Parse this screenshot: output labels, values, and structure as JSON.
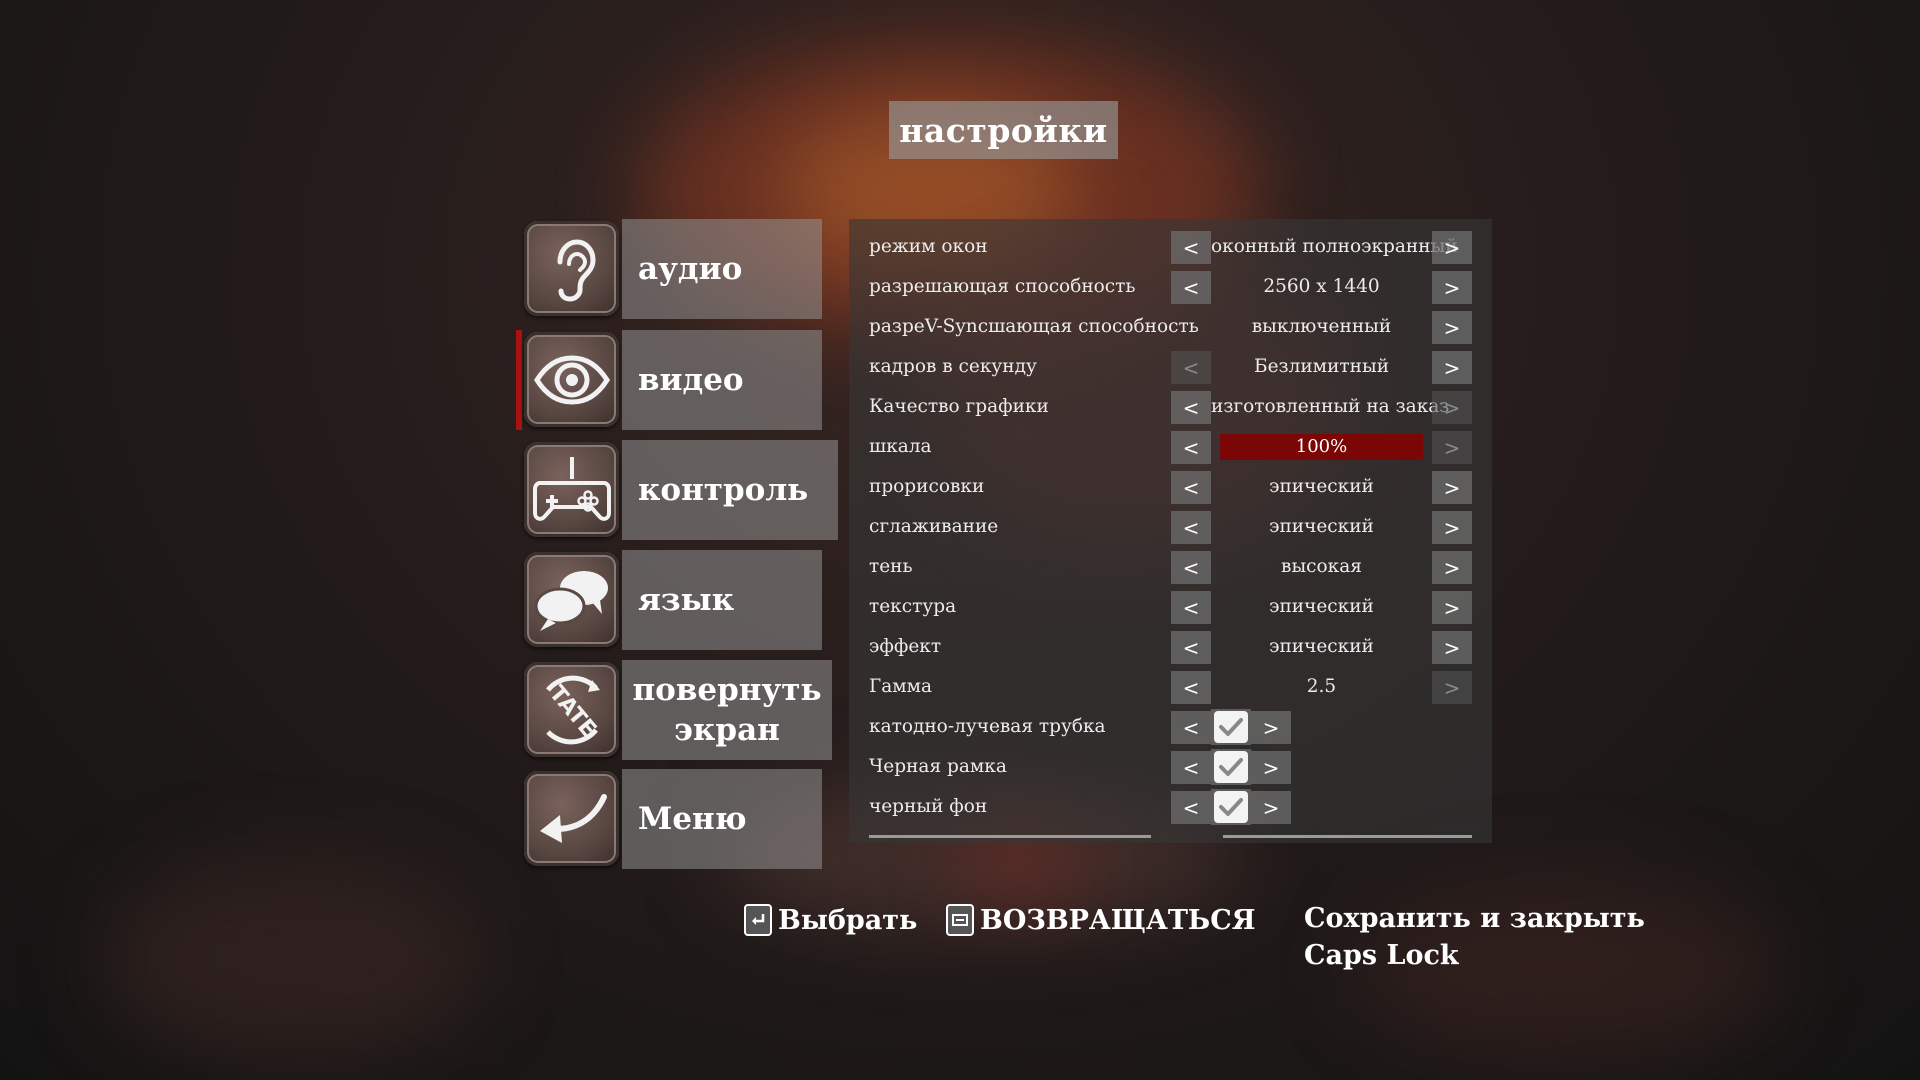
{
  "title": "настройки",
  "menu": [
    {
      "label": "аудио",
      "icon": "ear-icon"
    },
    {
      "label": "видео",
      "icon": "eye-icon",
      "active": true
    },
    {
      "label": "контроль",
      "icon": "gamepad-icon"
    },
    {
      "label": "язык",
      "icon": "speech-bubbles-icon"
    },
    {
      "label": "повернуть экран",
      "icon": "tate-rotate-icon",
      "icon_text": "TATE"
    },
    {
      "label": "Меню",
      "icon": "back-arrow-icon"
    }
  ],
  "settings": [
    {
      "name": "режим окон",
      "value": "оконный полноэкранный"
    },
    {
      "name": "разрешающая способность",
      "value": "2560 x 1440"
    },
    {
      "name": "разреV-Syncшающая способность",
      "value": "выключенный"
    },
    {
      "name": "кадров в секунду",
      "value": "Безлимитный"
    },
    {
      "name": "Качество графики",
      "value": "изготовленный на заказ"
    },
    {
      "name": "шкала",
      "value": "100%",
      "fill": 1.0
    },
    {
      "name": "прорисовки",
      "value": "эпический"
    },
    {
      "name": "сглаживание",
      "value": "эпический"
    },
    {
      "name": "тень",
      "value": "высокая"
    },
    {
      "name": "текстура",
      "value": "эпический"
    },
    {
      "name": "эффект",
      "value": "эпический"
    },
    {
      "name": "Гамма",
      "value": "2.5"
    },
    {
      "name": "катодно-лучевая трубка",
      "checked": true
    },
    {
      "name": "Черная рамка",
      "checked": true
    },
    {
      "name": "черный фон",
      "checked": true
    }
  ],
  "arrows": {
    "left": "<",
    "right": ">"
  },
  "hints": {
    "select": "Выбрать",
    "back": "ВОЗВРАЩАТЬСЯ",
    "save_line1": "Сохранить и закрыть",
    "save_line2": "Caps Lock"
  },
  "colors": {
    "accent_red": "#7a0606",
    "active_marker": "#aa1111"
  }
}
